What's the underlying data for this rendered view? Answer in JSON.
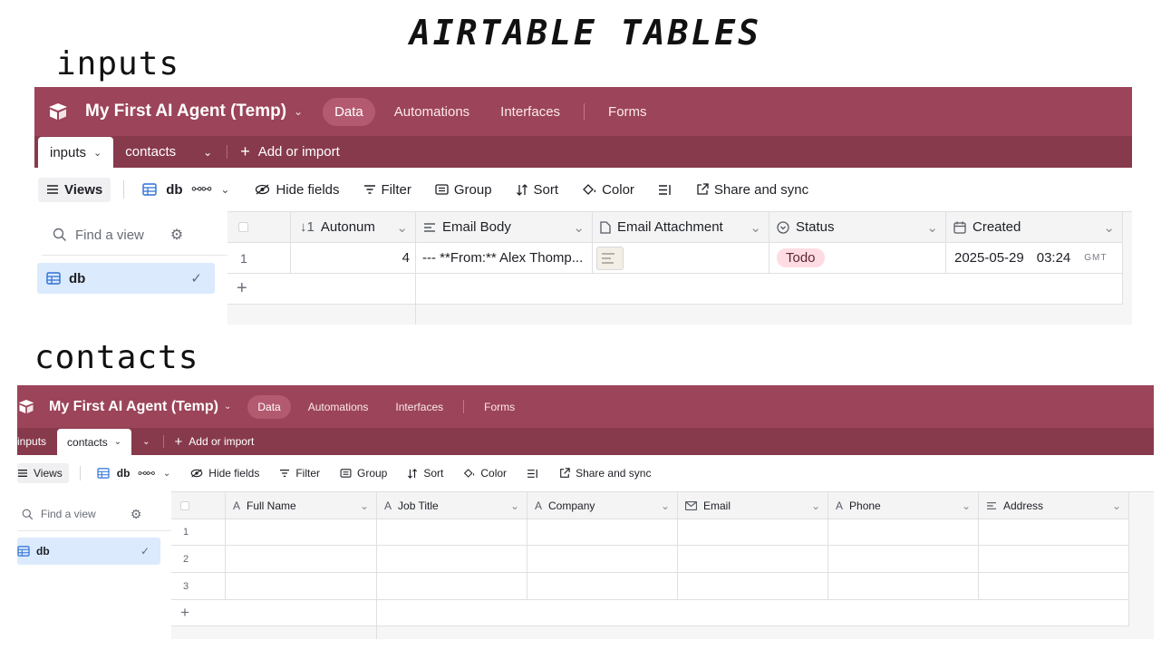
{
  "page": {
    "title": "AIRTABLE TABLES",
    "label_inputs": "inputs",
    "label_contacts": "contacts"
  },
  "colors": {
    "topbar": "#9c4459",
    "tabsbar": "#873a4c",
    "active_nav": "#b45a70",
    "status_todo": "#ffdce4",
    "selected_view": "#dbeafc"
  },
  "app": {
    "base_name": "My First AI Agent (Temp)",
    "nav": [
      "Data",
      "Automations",
      "Interfaces",
      "Forms"
    ],
    "tables": [
      "inputs",
      "contacts"
    ],
    "add_or_import": "Add or import",
    "toolbar": {
      "views": "Views",
      "view_name": "db",
      "hide_fields": "Hide fields",
      "filter": "Filter",
      "group": "Group",
      "sort": "Sort",
      "color": "Color",
      "share": "Share and sync"
    },
    "sidebar": {
      "find_placeholder": "Find a view",
      "view": "db"
    }
  },
  "inputs_table": {
    "columns": [
      {
        "name": "Autonum",
        "icon": "autonumber-icon"
      },
      {
        "name": "Email Body",
        "icon": "long-text-icon"
      },
      {
        "name": "Email Attachment",
        "icon": "attachment-icon"
      },
      {
        "name": "Status",
        "icon": "single-select-icon"
      },
      {
        "name": "Created",
        "icon": "created-time-icon"
      }
    ],
    "rows": [
      {
        "num": "1",
        "autonum": "4",
        "email_body": "--- **From:** Alex Thomp...",
        "status": "Todo",
        "created_date": "2025-05-29",
        "created_time": "03:24",
        "tz": "GMT"
      }
    ]
  },
  "contacts_table": {
    "columns": [
      {
        "name": "Full Name",
        "icon": "text-icon"
      },
      {
        "name": "Job Title",
        "icon": "text-icon"
      },
      {
        "name": "Company",
        "icon": "text-icon"
      },
      {
        "name": "Email",
        "icon": "email-icon"
      },
      {
        "name": "Phone",
        "icon": "text-icon"
      },
      {
        "name": "Address",
        "icon": "long-text-icon"
      }
    ],
    "rows": [
      "1",
      "2",
      "3"
    ]
  }
}
